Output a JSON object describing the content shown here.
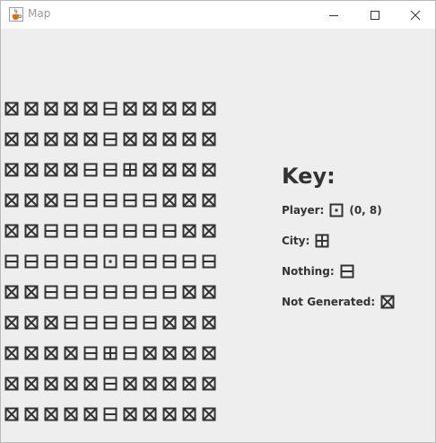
{
  "window": {
    "title": "Map",
    "app_icon": "java-cup-icon"
  },
  "map": {
    "rows": [
      [
        "X",
        "X",
        "X",
        "X",
        "X",
        "N",
        "X",
        "X",
        "X",
        "X",
        "X"
      ],
      [
        "X",
        "X",
        "X",
        "X",
        "X",
        "N",
        "X",
        "X",
        "X",
        "X",
        "X"
      ],
      [
        "X",
        "X",
        "X",
        "X",
        "N",
        "N",
        "C",
        "X",
        "X",
        "X",
        "X"
      ],
      [
        "X",
        "X",
        "X",
        "N",
        "N",
        "N",
        "N",
        "N",
        "X",
        "X",
        "X"
      ],
      [
        "X",
        "X",
        "N",
        "N",
        "N",
        "N",
        "N",
        "N",
        "N",
        "X",
        "X"
      ],
      [
        "N",
        "N",
        "N",
        "N",
        "N",
        "P",
        "N",
        "N",
        "N",
        "N",
        "N"
      ],
      [
        "X",
        "X",
        "N",
        "N",
        "N",
        "N",
        "N",
        "N",
        "N",
        "X",
        "X"
      ],
      [
        "X",
        "X",
        "X",
        "N",
        "N",
        "N",
        "N",
        "N",
        "X",
        "X",
        "X"
      ],
      [
        "X",
        "X",
        "X",
        "X",
        "N",
        "C",
        "N",
        "X",
        "X",
        "X",
        "X"
      ],
      [
        "X",
        "X",
        "X",
        "X",
        "X",
        "N",
        "X",
        "X",
        "X",
        "X",
        "X"
      ],
      [
        "X",
        "X",
        "X",
        "X",
        "X",
        "N",
        "X",
        "X",
        "X",
        "X",
        "X"
      ]
    ],
    "legend_codes": {
      "X": "not-generated-icon",
      "N": "nothing-icon",
      "C": "city-icon",
      "P": "player-icon"
    }
  },
  "key": {
    "title": "Key:",
    "player_label": "Player:",
    "player_coords": "(0, 8)",
    "city_label": "City:",
    "nothing_label": "Nothing:",
    "not_generated_label": "Not Generated:"
  }
}
